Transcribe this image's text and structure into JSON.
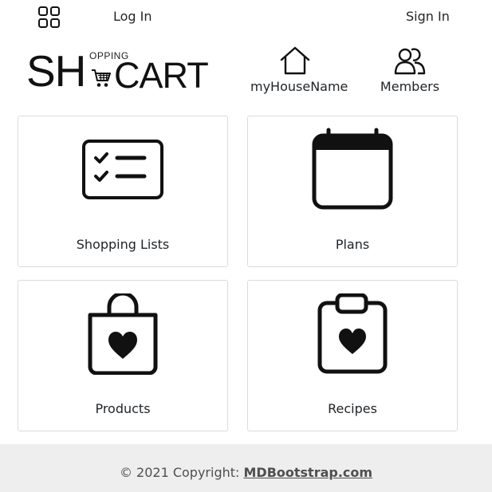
{
  "nav": {
    "login_label": "Log In",
    "signin_label": "Sign In",
    "menu_icon": "grid-icon"
  },
  "logo": {
    "big_letters": "SH",
    "small_letters": "OPPING",
    "tail_letters": "CART",
    "icon": "cart-icon"
  },
  "header": {
    "house": {
      "label": "myHouseName",
      "icon": "house-icon"
    },
    "members": {
      "label": "Members",
      "icon": "members-icon"
    }
  },
  "cards": [
    {
      "label": "Shopping Lists",
      "icon": "checklist-icon"
    },
    {
      "label": "Plans",
      "icon": "calendar-icon"
    },
    {
      "label": "Products",
      "icon": "shopping-bag-heart-icon"
    },
    {
      "label": "Recipes",
      "icon": "clipboard-heart-icon"
    }
  ],
  "footer": {
    "copyright": "© 2021 Copyright: ",
    "link_text": "MDBootstrap.com"
  },
  "colors": {
    "footer_bg": "#eeeeee",
    "text": "#212529",
    "card_border": "#dcdcdc"
  }
}
